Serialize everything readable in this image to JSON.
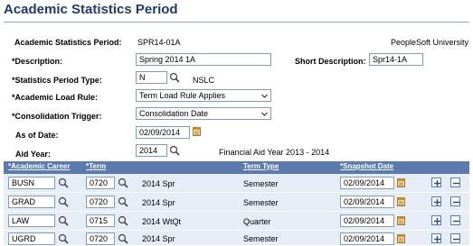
{
  "page": {
    "title": "Academic Statistics Period",
    "institution": "PeopleSoft University"
  },
  "form": {
    "period_label": "Academic Statistics Period:",
    "period_value": "SPR14-01A",
    "description_label": "*Description:",
    "description_value": "Spring 2014 1A",
    "short_description_label": "Short Description:",
    "short_description_value": "Spr14-1A",
    "period_type_label": "*Statistics Period Type:",
    "period_type_value": "N",
    "period_type_desc": "NSLC",
    "load_rule_label": "*Academic Load Rule:",
    "load_rule_value": "Term Load Rule Applies",
    "consolidation_label": "*Consolidation Trigger:",
    "consolidation_value": "Consolidation Date",
    "as_of_label": "As of Date:",
    "as_of_value": "02/09/2014",
    "aid_year_label": "Aid Year:",
    "aid_year_value": "2014",
    "aid_year_desc": "Financial Aid Year 2013 - 2014"
  },
  "grid": {
    "headers": {
      "career": "*Academic Career",
      "term": "*Term",
      "term_type": "Term Type",
      "snapshot": "*Snapshot Date"
    },
    "rows": [
      {
        "career": "BUSN",
        "term": "0720",
        "term_desc": "2014 Spr",
        "term_type": "Semester",
        "snapshot": "02/09/2014"
      },
      {
        "career": "GRAD",
        "term": "0720",
        "term_desc": "2014 Spr",
        "term_type": "Semester",
        "snapshot": "02/09/2014"
      },
      {
        "career": "LAW",
        "term": "0715",
        "term_desc": "2014 WtQt",
        "term_type": "Quarter",
        "snapshot": "02/09/2014"
      },
      {
        "career": "UGRD",
        "term": "0720",
        "term_desc": "2014 Spr",
        "term_type": "Semester",
        "snapshot": "02/09/2014"
      }
    ]
  },
  "icons": {
    "lookup": "magnifier-icon",
    "calendar": "calendar-icon",
    "add": "plus-icon",
    "delete": "minus-icon",
    "dropdown": "chevron-down-icon"
  },
  "colors": {
    "title": "#1f3a6b",
    "grid_header": "#5a7ab0",
    "grid_row": "#e6edf6",
    "field_border": "#7f9db9"
  }
}
